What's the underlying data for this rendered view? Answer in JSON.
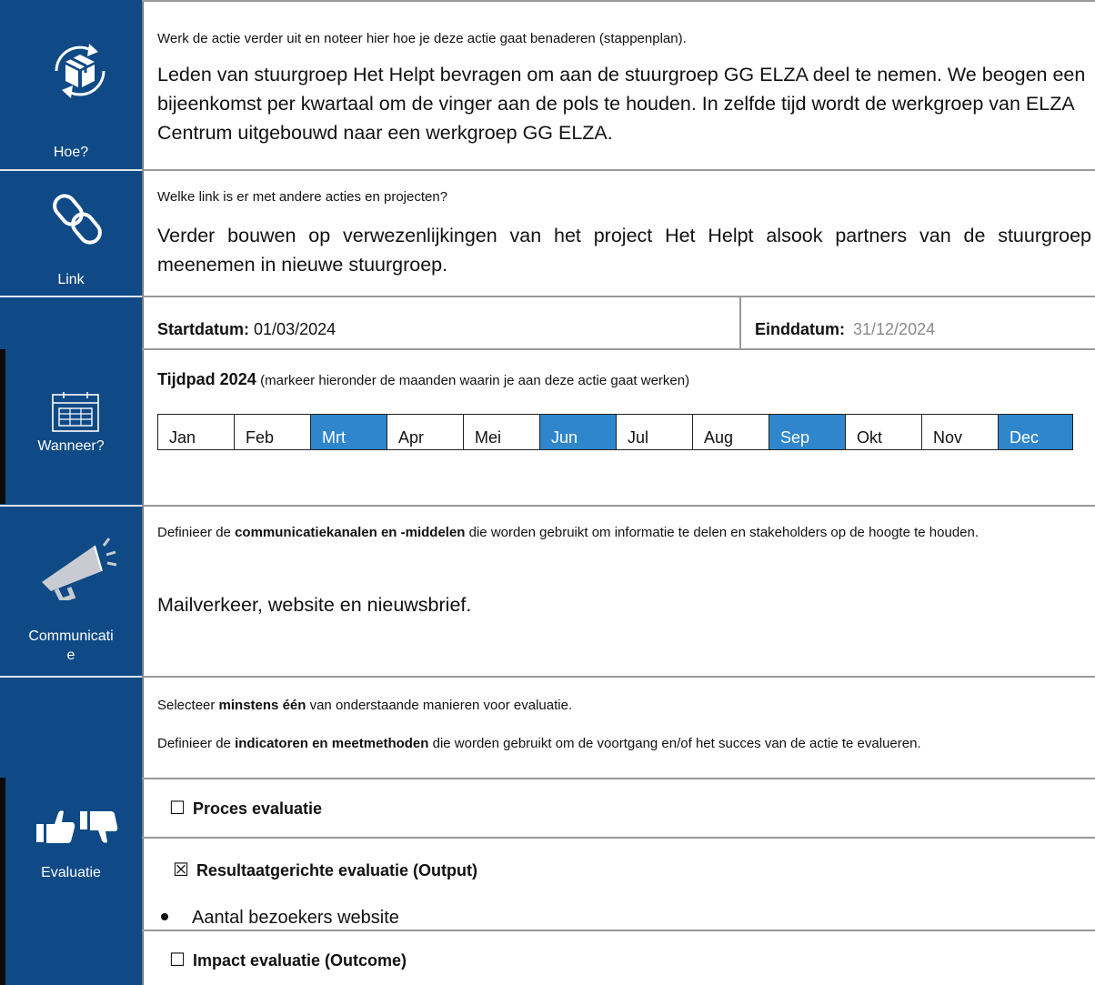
{
  "sections": {
    "hoe": {
      "label": "Hoe?",
      "question": "Werk de actie verder uit en noteer hier hoe je deze actie gaat benaderen (stappenplan).",
      "answer": "Leden van stuurgroep Het Helpt bevragen om aan de stuurgroep GG ELZA deel te nemen.  We beogen een bijeenkomst per kwartaal om de vinger aan de pols te houden.  In zelfde tijd wordt de werkgroep van ELZA Centrum uitgebouwd naar een werkgroep GG ELZA."
    },
    "link": {
      "label": "Link",
      "question": "Welke link is er met andere acties en projecten?",
      "answer": "Verder bouwen op verwezenlijkingen van het project Het Helpt alsook partners van de stuurgroep meenemen in nieuwe stuurgroep."
    },
    "wanneer": {
      "label": "Wanneer?",
      "start_label": "Startdatum:",
      "start_value": "01/03/2024",
      "end_label": "Einddatum:",
      "end_value": "31/12/2024",
      "timeline_title": "Tijdpad 2024",
      "timeline_note": "(markeer hieronder de maanden waarin je aan deze actie gaat werken)",
      "months": [
        {
          "name": "Jan",
          "selected": false
        },
        {
          "name": "Feb",
          "selected": false
        },
        {
          "name": "Mrt",
          "selected": true
        },
        {
          "name": "Apr",
          "selected": false
        },
        {
          "name": "Mei",
          "selected": false
        },
        {
          "name": "Jun",
          "selected": true
        },
        {
          "name": "Jul",
          "selected": false
        },
        {
          "name": "Aug",
          "selected": false
        },
        {
          "name": "Sep",
          "selected": true
        },
        {
          "name": "Okt",
          "selected": false
        },
        {
          "name": "Nov",
          "selected": false
        },
        {
          "name": "Dec",
          "selected": true
        }
      ],
      "selected_color": "#2f86cc"
    },
    "communicatie": {
      "label_line1": "Communicati",
      "label_line2": "e",
      "q_part1": "Definieer de ",
      "q_bold": "communicatiekanalen en -middelen",
      "q_part2": " die worden gebruikt om informatie te delen en stakeholders op de hoogte te houden.",
      "answer": "Mailverkeer, website en nieuwsbrief."
    },
    "evaluatie": {
      "label": "Evaluatie",
      "instr1_part1": "Selecteer ",
      "instr1_bold": "minstens één",
      "instr1_part2": " van onderstaande manieren voor evaluatie.",
      "instr2_part1": "Definieer de ",
      "instr2_bold": "indicatoren en meetmethoden",
      "instr2_part2": " die worden gebruikt om de voortgang en/of het succes van de actie te evalueren.",
      "options": [
        {
          "label": "Proces evaluatie",
          "checked": false,
          "box": "☐"
        },
        {
          "label": "Resultaatgerichte evaluatie (Output)",
          "checked": true,
          "box": "☒"
        },
        {
          "label": "Impact evaluatie (Outcome)",
          "checked": false,
          "box": "☐"
        }
      ],
      "output_indicator": "Aantal bezoekers website"
    }
  },
  "colors": {
    "sidebar": "#0f4a86",
    "month_highlight": "#2f86cc",
    "muted_date": "#8a8a8a"
  }
}
